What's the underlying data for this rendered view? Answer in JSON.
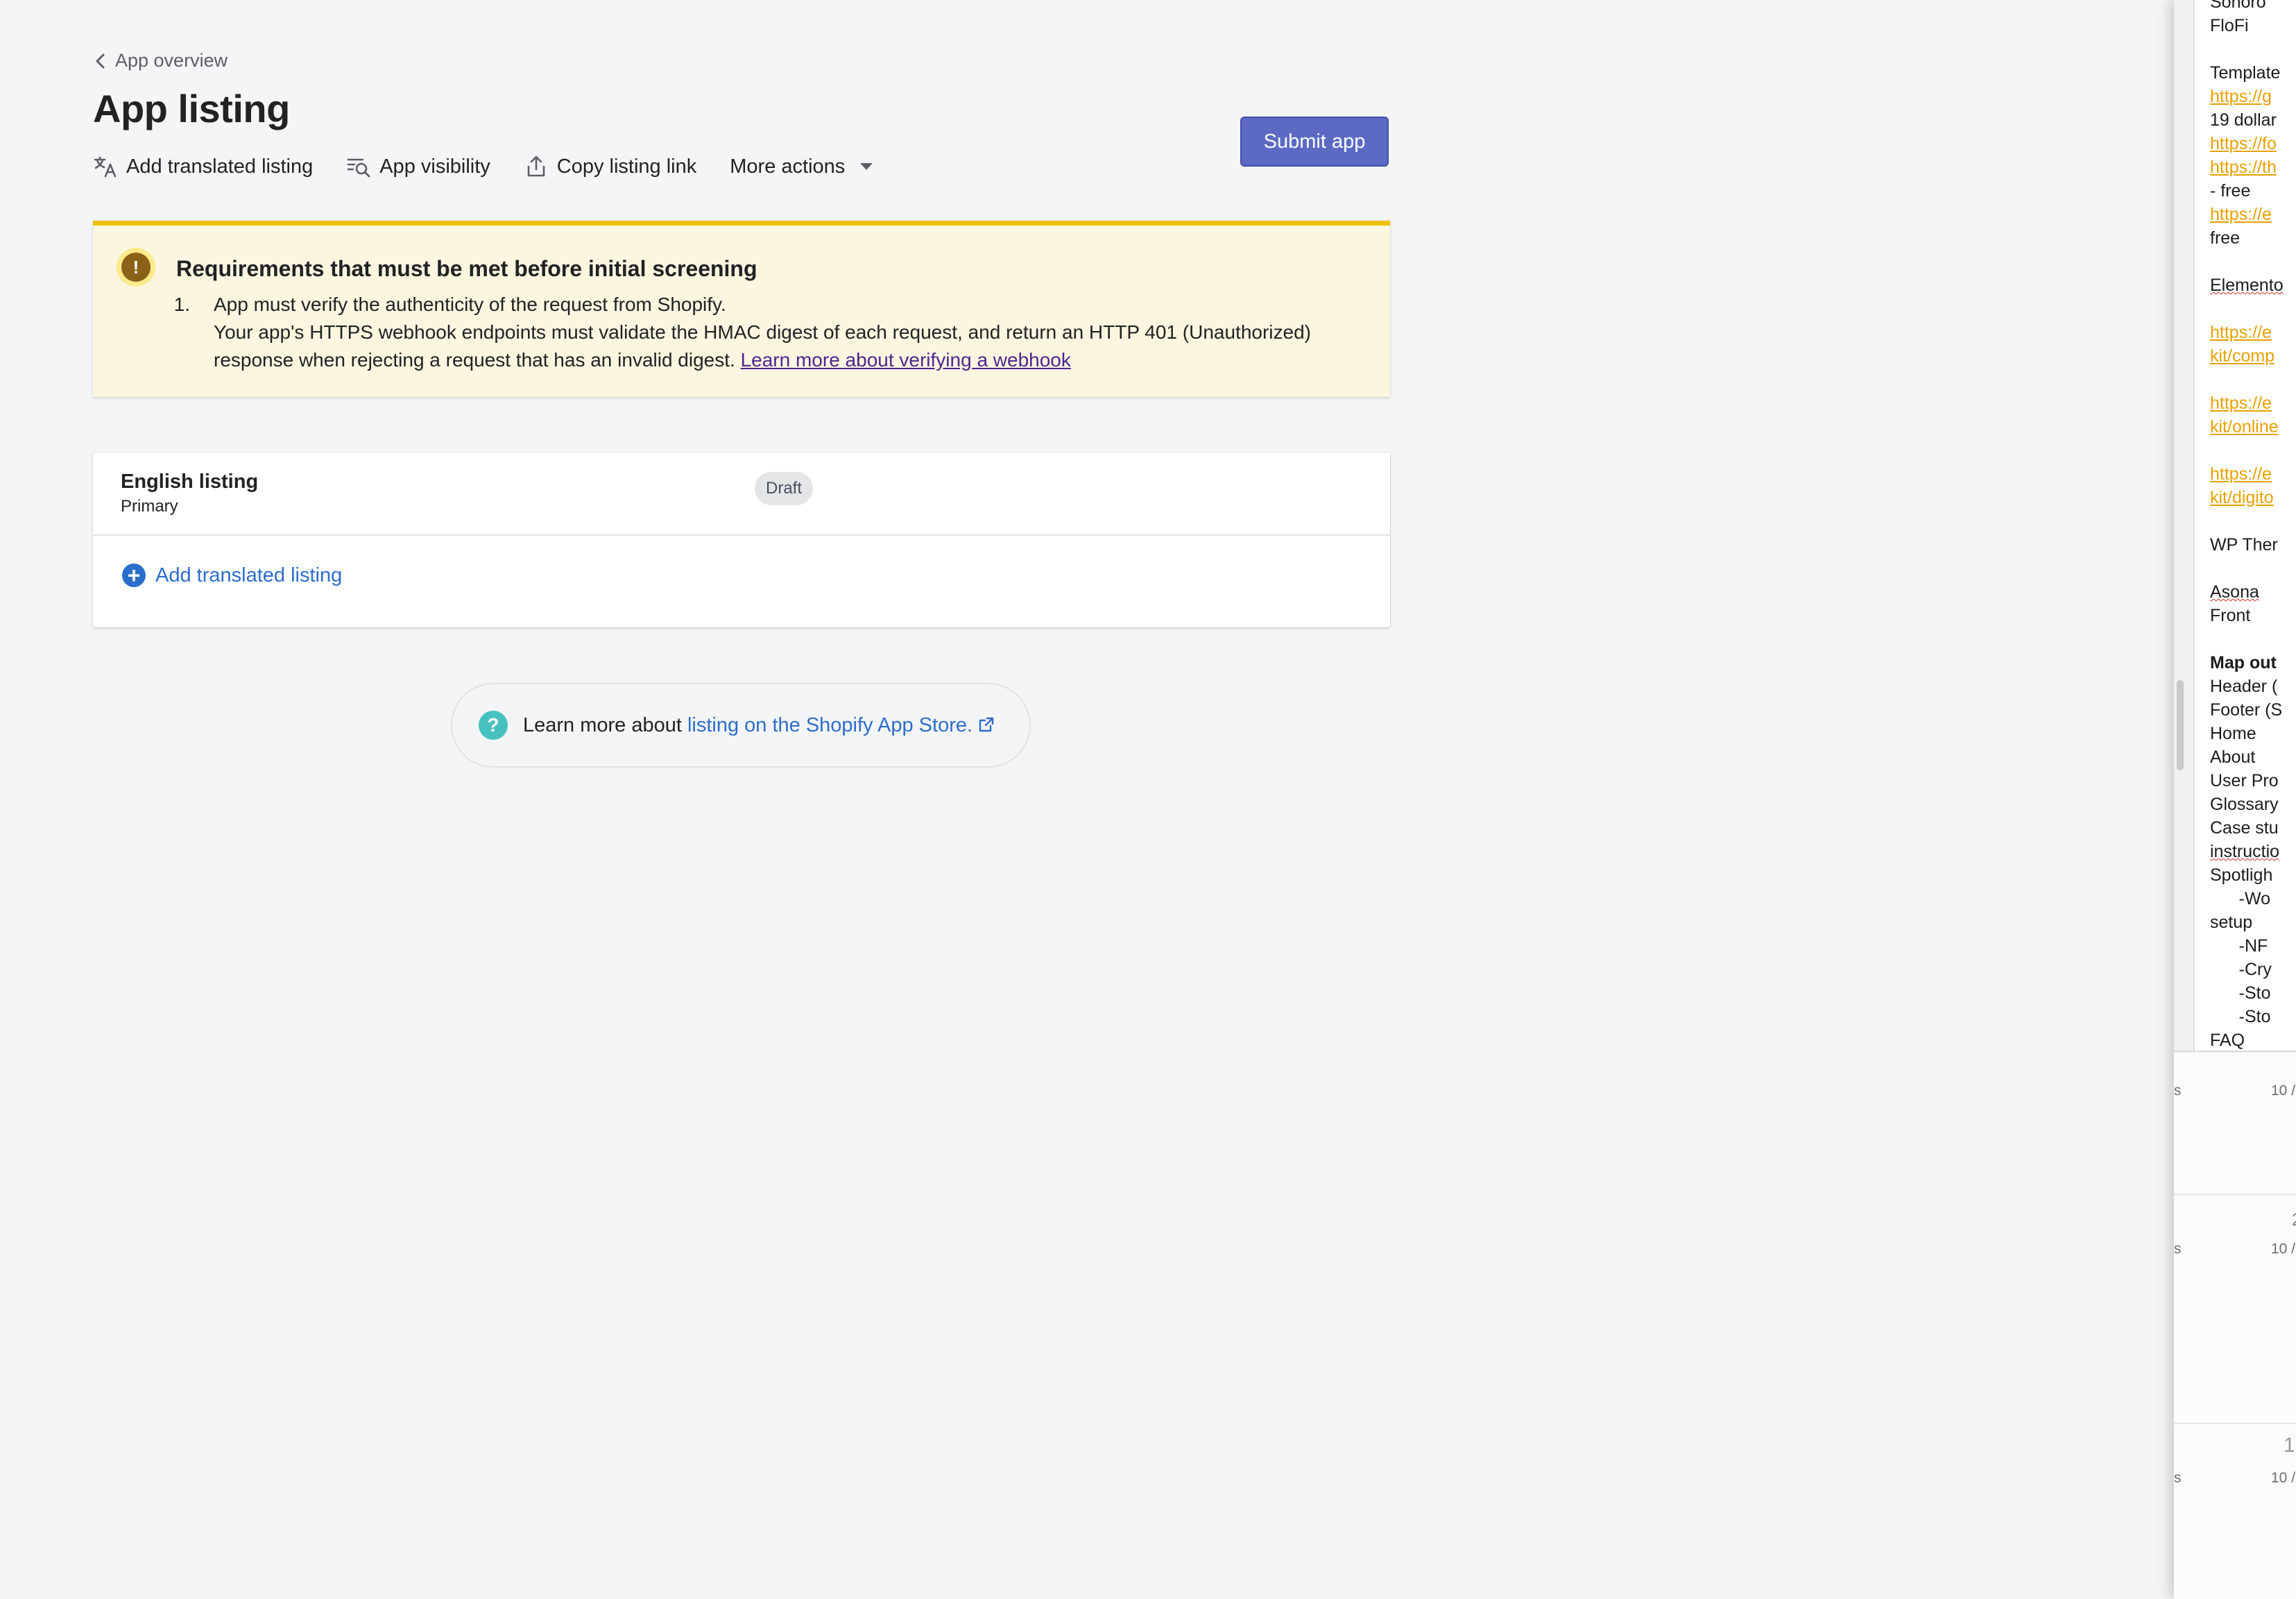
{
  "breadcrumb": {
    "label": "App overview"
  },
  "page": {
    "title": "App listing"
  },
  "actions": {
    "add_translated": "Add translated listing",
    "visibility": "App visibility",
    "copy_link": "Copy listing link",
    "more": "More actions"
  },
  "submit_button": "Submit app",
  "banner": {
    "title": "Requirements that must be met before initial screening",
    "item_number": "1.",
    "item_heading": "App must verify the authenticity of the request from Shopify.",
    "item_body": "Your app's HTTPS webhook endpoints must validate the HMAC digest of each request, and return an HTTP 401 (Unauthorized) response when rejecting a request that has an invalid digest.",
    "link": "Learn more about verifying a webhook"
  },
  "listing": {
    "name": "English listing",
    "subtitle": "Primary",
    "badge": "Draft",
    "add_translated": "Add translated listing"
  },
  "help": {
    "prefix": "Learn more about",
    "link": "listing on the Shopify App Store."
  },
  "side_doc": {
    "lines": [
      "Sonoro",
      "FloFi",
      "",
      "Template",
      "https://g",
      "19 dollar",
      "https://fo",
      "https://th",
      "- free",
      "https://e",
      "free",
      "",
      "Elemento",
      "",
      "https://e",
      "kit/comp",
      "",
      "https://e",
      "kit/online",
      "",
      "https://e",
      "kit/digito",
      "",
      "WP Ther",
      "",
      "Asona",
      "Front",
      "",
      "Map out",
      "Header (",
      "Footer (S",
      "Home",
      "About",
      "User Pro",
      "Glossary",
      "Case stu",
      "instructio",
      "Spotligh",
      "      -Wo",
      "setup",
      "      -NF",
      "      -Cry",
      "      -Sto",
      "      -Sto",
      "FAQ"
    ],
    "bg_rows": [
      {
        "label": "s",
        "date": "10 /"
      },
      {
        "label": "s",
        "date": "10 /"
      },
      {
        "label": "s",
        "date": "10 /"
      }
    ],
    "bg_numbers": [
      "2",
      "1("
    ]
  }
}
